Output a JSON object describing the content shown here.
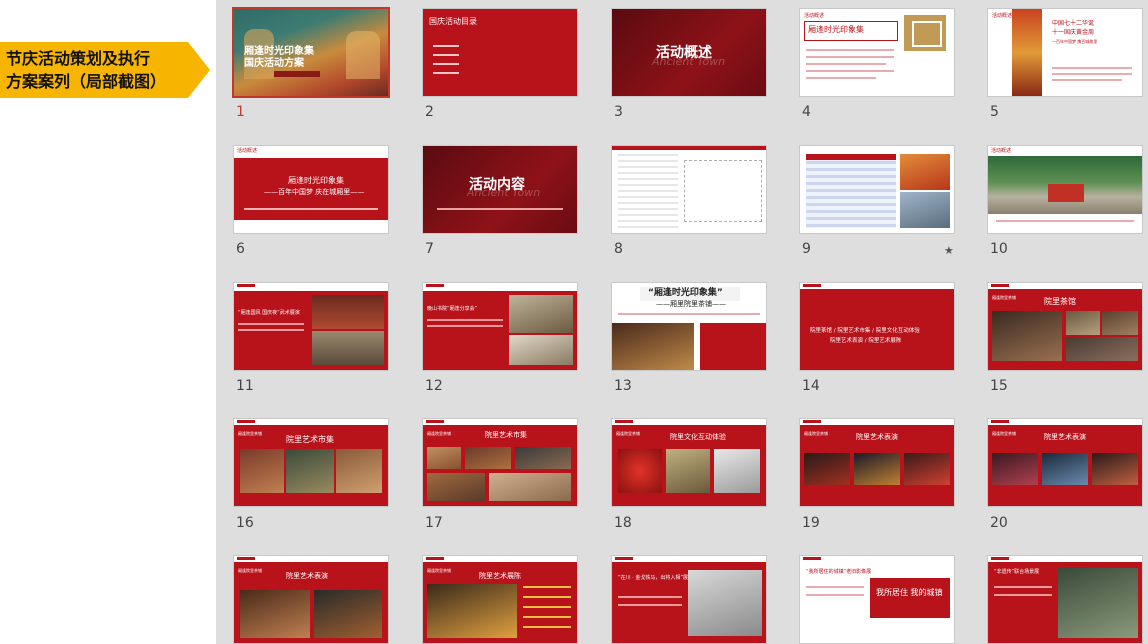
{
  "banner": {
    "line1": "节庆活动策划及执行",
    "line2": "方案案列（局部截图）"
  },
  "slide_numbers": [
    "1",
    "2",
    "3",
    "4",
    "5",
    "6",
    "7",
    "8",
    "9",
    "10",
    "11",
    "12",
    "13",
    "14",
    "15",
    "16",
    "17",
    "18",
    "19",
    "20"
  ],
  "slide9_star": "★",
  "slides": {
    "s1": {
      "title1": "厢逢时光印象集",
      "title2": "国庆活动方案"
    },
    "s2": {
      "title": "国庆活动目录"
    },
    "s3": {
      "title": "活动概述",
      "ghost": "Ancient Town"
    },
    "s4": {
      "label": "活动概述",
      "title": "厢逢时光印象集"
    },
    "s5": {
      "label": "活动概述",
      "t1": "中国七十二华诞",
      "t2": "十一国庆黄金周",
      "t3": "一百年中国梦 携百城故里"
    },
    "s6": {
      "label": "活动概述",
      "title": "厢逢时光印象集",
      "sub": "——百年中国梦  庆在城厢里——"
    },
    "s7": {
      "title": "活动内容",
      "ghost": "Ancient Town"
    },
    "s10": {
      "label": "活动概述"
    },
    "s11": {
      "title": "“厢逢国风 国庆夜”武术展演"
    },
    "s12": {
      "title": "晚山书院“厢逢分享会”"
    },
    "s13": {
      "title1": "“厢逢时光印象集”",
      "title2": "——厢里院里茶铺——"
    },
    "s14": {
      "title1": "院里茶馆 / 院里艺术市集 / 院里文化互动体验",
      "title2": "院里艺术表演 / 院里艺术展陈"
    },
    "s15": {
      "label": "厢逢院里茶铺",
      "title": "院里茶馆"
    },
    "s16": {
      "label": "厢逢院里茶铺",
      "title": "院里艺术市集"
    },
    "s17": {
      "label": "厢逢院里茶铺",
      "title": "院里艺术市集"
    },
    "s18": {
      "label": "厢逢院里茶铺",
      "title": "院里文化互动体验"
    },
    "s19": {
      "label": "厢逢院里茶铺",
      "title": "院里艺术表演"
    },
    "s20": {
      "label": "厢逢院里茶铺",
      "title": "院里艺术表演"
    },
    "s21": {
      "label": "厢逢院里茶铺",
      "title": "院里艺术表演"
    },
    "s22": {
      "label": "厢逢院里茶铺",
      "title": "院里艺术展陈"
    },
    "s23": {
      "title": "“在川 · 金戈铁马，出将入相”展"
    },
    "s24": {
      "title": "“我所居住的城镇”老旧影像展",
      "art": "我所居住 我的城镇"
    },
    "s25": {
      "title": "“非遗传”联合场景展"
    }
  }
}
